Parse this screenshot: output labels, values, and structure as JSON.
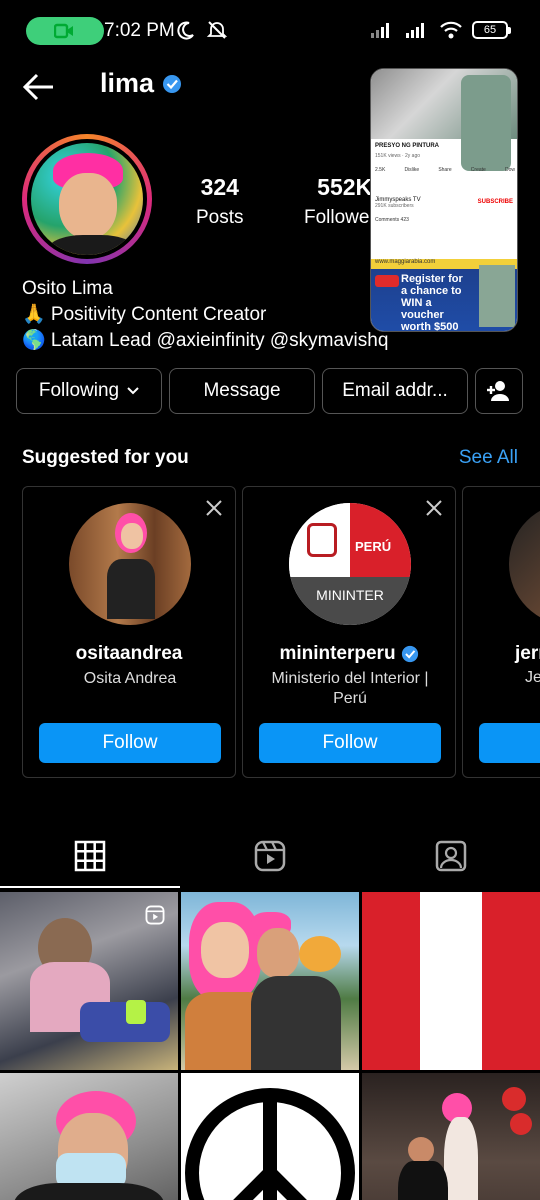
{
  "status_bar": {
    "time": "7:02 PM",
    "battery": "65",
    "call_color": "#3ecf7a"
  },
  "header": {
    "username": "lima",
    "verified": true,
    "back_icon": "arrow-left-icon"
  },
  "profile": {
    "posts_count": "324",
    "posts_label": "Posts",
    "followers_count": "552K",
    "followers_label": "Followers",
    "display_name": "Osito Lima",
    "bio_line1": "🙏 Positivity Content Creator",
    "bio_line2": "🌎 Latam Lead @axieinfinity @skymavishq"
  },
  "pip_video": {
    "title": "PRESYO NG PINTURA",
    "meta": "151K views · 2y ago",
    "actions": [
      "2.5K",
      "Dislike",
      "Share",
      "Create",
      "Dow"
    ],
    "channel": "Jimmyspeaks TV",
    "channel_subs": "291K subscribers",
    "subscribe_label": "SUBSCRIBE",
    "comments": "Comments 423",
    "ad_url": "www.maggiarabia.com",
    "ad_text": "Register for a chance to WIN a voucher worth $500"
  },
  "actions": {
    "following": "Following",
    "message": "Message",
    "email": "Email addr...",
    "add_person_icon": "add-person-icon"
  },
  "suggested": {
    "heading": "Suggested for you",
    "see_all": "See All",
    "cards": [
      {
        "username": "ositaandrea",
        "full_name": "Osita Andrea",
        "verified": false,
        "follow": "Follow"
      },
      {
        "username": "mininterperu",
        "full_name": "Ministerio del Interior | Perú",
        "verified": true,
        "follow": "Follow",
        "logo_top": "PERÚ",
        "logo_bottom": "MININTER"
      },
      {
        "username": "jerr",
        "full_name": "Je",
        "verified": false,
        "follow": "Follow"
      }
    ]
  },
  "tabs": [
    "grid-icon",
    "reels-icon",
    "tagged-icon"
  ],
  "colors": {
    "accent_blue": "#0a95f6",
    "link_blue": "#3aa1f5",
    "verified_blue": "#3897f0"
  }
}
